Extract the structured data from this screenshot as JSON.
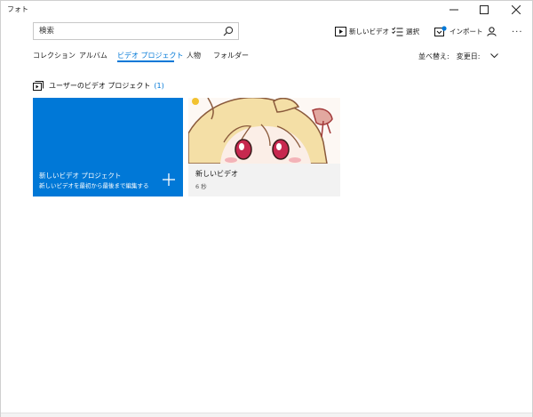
{
  "window": {
    "title": "フォト"
  },
  "search": {
    "placeholder": "検索"
  },
  "toolbar": {
    "new_video": "新しいビデオ",
    "select": "選択",
    "import": "インポート",
    "more": "..."
  },
  "nav": {
    "tabs": [
      {
        "label": "コレクション"
      },
      {
        "label": "アルバム"
      },
      {
        "label": "ビデオ プロジェクト",
        "active": true
      },
      {
        "label": "人物"
      },
      {
        "label": "フォルダー"
      }
    ]
  },
  "sort": {
    "label": "並べ替え:",
    "value": "変更日:"
  },
  "section": {
    "title": "ユーザーのビデオ プロジェクト",
    "count": "(1)"
  },
  "new_project": {
    "title": "新しいビデオ プロジェクト",
    "subtitle": "新しいビデオを最初から最後まで編集する"
  },
  "project": {
    "title": "新しいビデオ",
    "duration": "6 秒"
  },
  "colors": {
    "accent": "#0078d7",
    "window_bg": "#ffffff",
    "card_bg": "#f2f2f2"
  },
  "icons": [
    "search-icon",
    "film-icon",
    "checklist-icon",
    "import-icon",
    "person-icon",
    "more-icon",
    "project-icon",
    "plus-icon",
    "chevron-down-icon",
    "minimize-icon",
    "maximize-icon",
    "close-icon"
  ]
}
